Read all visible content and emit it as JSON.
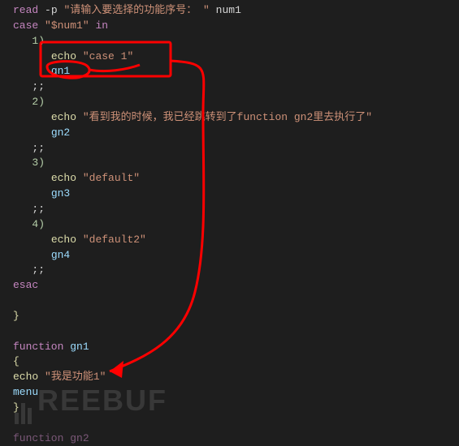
{
  "code": {
    "read_kw": "read",
    "read_flag": "-p",
    "read_prompt": "\"请输入要选择的功能序号： \"",
    "read_var": "num1",
    "case_kw": "case",
    "case_expr": "\"$num1\"",
    "in_kw": "in",
    "esac_kw": "esac",
    "function_kw": "function",
    "function_name": "gn1",
    "echo_cmd": "echo",
    "brace_open": "{",
    "brace_close": "}",
    "double_semi": ";;",
    "menu_call": "menu",
    "branches": {
      "b1": {
        "pattern": "1)",
        "echo_str": "\"case 1\"",
        "fn": "gn1"
      },
      "b2": {
        "pattern": "2)",
        "echo_str": "\"看到我的时候，我已经跳转到了function gn2里去执行了\"",
        "fn": "gn2"
      },
      "b3": {
        "pattern": "3)",
        "echo_str": "\"default\"",
        "fn": "gn3"
      },
      "b4": {
        "pattern": "4)",
        "echo_str": "\"default2\"",
        "fn": "gn4"
      }
    },
    "fn_body_echo_str": "\"我是功能1\"",
    "closing_brace": "}",
    "partial_last": "function gn2"
  },
  "annotation": {
    "box_color": "#ff0000",
    "arrow_color": "#ff0000"
  },
  "watermark_text": "REEBUF"
}
